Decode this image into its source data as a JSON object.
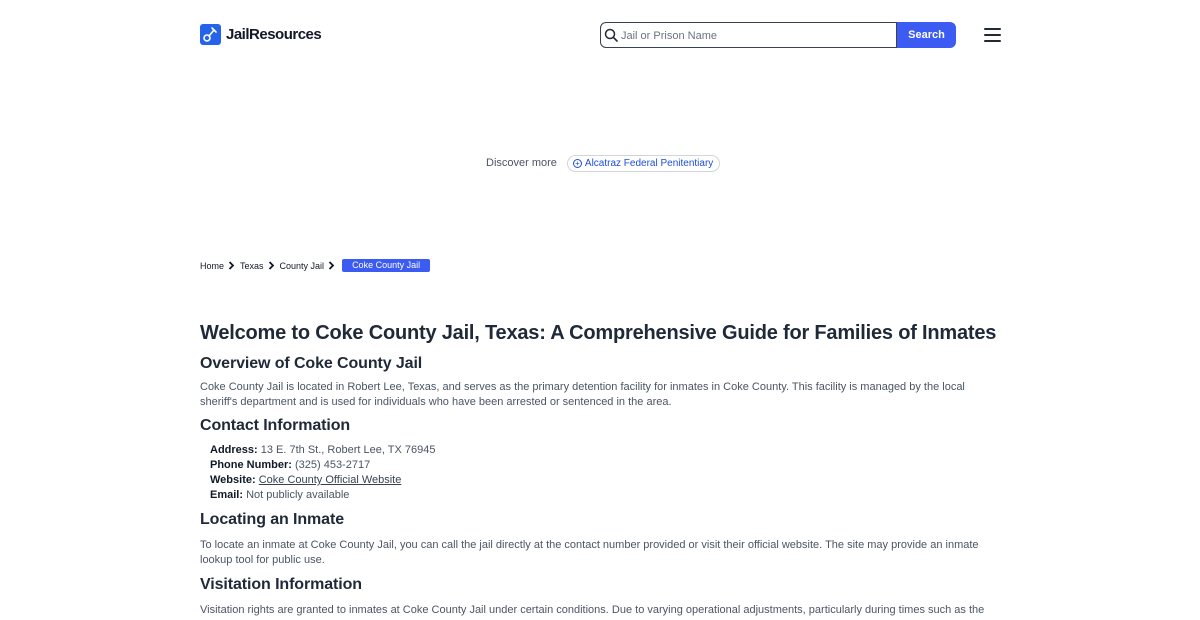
{
  "header": {
    "logo_text": "JailResources",
    "search": {
      "placeholder": "Jail or Prison Name",
      "value": "",
      "button_label": "Search"
    }
  },
  "discover": {
    "label": "Discover more",
    "chip_label": "Alcatraz Federal Penitentiary"
  },
  "breadcrumb": {
    "items": [
      "Home",
      "Texas",
      "County Jail"
    ],
    "current": "Coke County Jail"
  },
  "content": {
    "title": "Welcome to Coke County Jail, Texas: A Comprehensive Guide for Families of Inmates",
    "overview_heading": "Overview of Coke County Jail",
    "overview_text": "Coke County Jail is located in Robert Lee, Texas, and serves as the primary detention facility for inmates in Coke County. This facility is managed by the local sheriff's department and is used for individuals who have been arrested or sentenced in the area.",
    "contact_heading": "Contact Information",
    "contact": {
      "address_label": "Address:",
      "address_value": "13 E. 7th St., Robert Lee, TX 76945",
      "phone_label": "Phone Number:",
      "phone_value": "(325) 453-2717",
      "website_label": "Website:",
      "website_value": "Coke County Official Website",
      "email_label": "Email:",
      "email_value": "Not publicly available"
    },
    "locating_heading": "Locating an Inmate",
    "locating_text": "To locate an inmate at Coke County Jail, you can call the jail directly at the contact number provided or visit their official website. The site may provide an inmate lookup tool for public use.",
    "visitation_heading": "Visitation Information",
    "visitation_text": "Visitation rights are granted to inmates at Coke County Jail under certain conditions. Due to varying operational adjustments, particularly during times such as the"
  }
}
